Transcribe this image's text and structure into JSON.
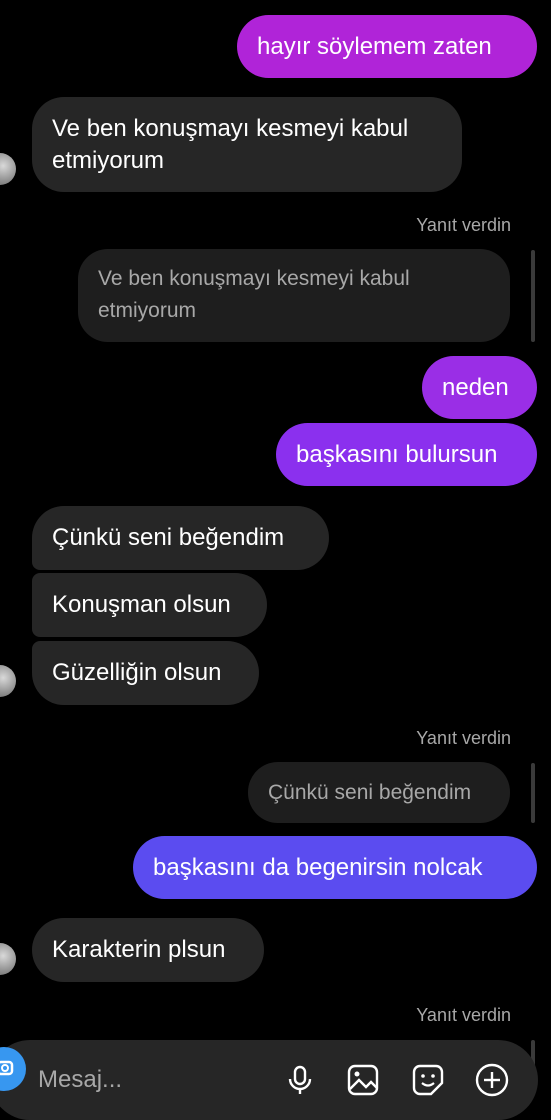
{
  "messages": {
    "m1": "hayır söylemem zaten",
    "m2": "Ve ben konuşmayı kesmeyi kabul etmiyorum",
    "m2_line1": "Ve ben konuşmayı kesmeyi kabul",
    "m2_line2": "etmiyorum",
    "reply_note_1": "Yanıt verdin",
    "quote_1_line1": "Ve ben konuşmayı kesmeyi kabul",
    "quote_1_line2": "etmiyorum",
    "m3": "neden",
    "m4": "başkasını bulursun",
    "m5": "Çünkü seni beğendim",
    "m6": "Konuşman olsun",
    "m7": "Güzelliğin olsun",
    "reply_note_2": "Yanıt verdin",
    "quote_2": "Çünkü seni beğendim",
    "m8": "başkasını da begenirsin nolcak",
    "m9": "Karakterin plsun",
    "reply_note_3": "Yanıt verdin"
  },
  "composer": {
    "placeholder": "Mesaj..."
  },
  "icons": {
    "camera": "camera-icon",
    "mic": "microphone-icon",
    "gallery": "gallery-icon",
    "sticker": "sticker-icon",
    "add": "plus-circle-icon"
  },
  "colors": {
    "outgoing_magenta": "#b024d8",
    "outgoing_purple": "#8b30ee",
    "outgoing_blue": "#5b4cf0",
    "incoming": "#262626"
  }
}
